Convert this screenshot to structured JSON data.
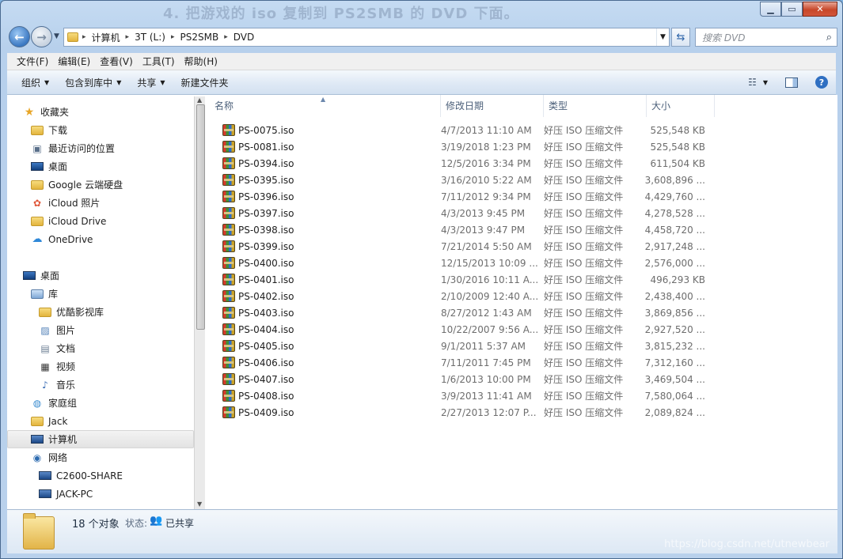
{
  "window": {
    "ghost_title": "4.   把游戏的 iso 复制到 PS2SMB 的 DVD 下面。",
    "min_icon": "minimize-icon",
    "max_icon": "maximize-icon",
    "close_label": "✕"
  },
  "address_bar": {
    "segments": [
      "计算机",
      "3T (L:)",
      "PS2SMB",
      "DVD"
    ],
    "separator": "▸"
  },
  "search": {
    "placeholder": "搜索 DVD"
  },
  "menu": {
    "items": [
      "文件(F)",
      "编辑(E)",
      "查看(V)",
      "工具(T)",
      "帮助(H)"
    ]
  },
  "toolbar": {
    "organize": "组织",
    "include_in_library": "包含到库中",
    "share": "共享",
    "new_folder": "新建文件夹"
  },
  "nav": {
    "favorites": [
      "收藏夹",
      "下载",
      "最近访问的位置",
      "桌面",
      "Google 云端硬盘",
      "iCloud 照片",
      "iCloud Drive",
      "OneDrive"
    ],
    "desktop": "桌面",
    "library": "库",
    "library_items": [
      "优酷影视库",
      "图片",
      "文档",
      "视频",
      "音乐"
    ],
    "homegroup": "家庭组",
    "user": "Jack",
    "computer": "计算机",
    "network": "网络",
    "network_items": [
      "C2600-SHARE",
      "JACK-PC"
    ]
  },
  "columns": {
    "name": "名称",
    "date": "修改日期",
    "type": "类型",
    "size": "大小"
  },
  "files": [
    {
      "name": "PS-0075.iso",
      "date": "4/7/2013 11:10 AM",
      "type": "好压 ISO 压缩文件",
      "size": "525,548 KB"
    },
    {
      "name": "PS-0081.iso",
      "date": "3/19/2018 1:23 PM",
      "type": "好压 ISO 压缩文件",
      "size": "525,548 KB"
    },
    {
      "name": "PS-0394.iso",
      "date": "12/5/2016 3:34 PM",
      "type": "好压 ISO 压缩文件",
      "size": "611,504 KB"
    },
    {
      "name": "PS-0395.iso",
      "date": "3/16/2010 5:22 AM",
      "type": "好压 ISO 压缩文件",
      "size": "3,608,896 ..."
    },
    {
      "name": "PS-0396.iso",
      "date": "7/11/2012 9:34 PM",
      "type": "好压 ISO 压缩文件",
      "size": "4,429,760 ..."
    },
    {
      "name": "PS-0397.iso",
      "date": "4/3/2013 9:45 PM",
      "type": "好压 ISO 压缩文件",
      "size": "4,278,528 ..."
    },
    {
      "name": "PS-0398.iso",
      "date": "4/3/2013 9:47 PM",
      "type": "好压 ISO 压缩文件",
      "size": "4,458,720 ..."
    },
    {
      "name": "PS-0399.iso",
      "date": "7/21/2014 5:50 AM",
      "type": "好压 ISO 压缩文件",
      "size": "2,917,248 ..."
    },
    {
      "name": "PS-0400.iso",
      "date": "12/15/2013 10:09 ...",
      "type": "好压 ISO 压缩文件",
      "size": "2,576,000 ..."
    },
    {
      "name": "PS-0401.iso",
      "date": "1/30/2016 10:11 A...",
      "type": "好压 ISO 压缩文件",
      "size": "496,293 KB"
    },
    {
      "name": "PS-0402.iso",
      "date": "2/10/2009 12:40 A...",
      "type": "好压 ISO 压缩文件",
      "size": "2,438,400 ..."
    },
    {
      "name": "PS-0403.iso",
      "date": "8/27/2012 1:43 AM",
      "type": "好压 ISO 压缩文件",
      "size": "3,869,856 ..."
    },
    {
      "name": "PS-0404.iso",
      "date": "10/22/2007 9:56 A...",
      "type": "好压 ISO 压缩文件",
      "size": "2,927,520 ..."
    },
    {
      "name": "PS-0405.iso",
      "date": "9/1/2011 5:37 AM",
      "type": "好压 ISO 压缩文件",
      "size": "3,815,232 ..."
    },
    {
      "name": "PS-0406.iso",
      "date": "7/11/2011 7:45 PM",
      "type": "好压 ISO 压缩文件",
      "size": "7,312,160 ..."
    },
    {
      "name": "PS-0407.iso",
      "date": "1/6/2013 10:00 PM",
      "type": "好压 ISO 压缩文件",
      "size": "3,469,504 ..."
    },
    {
      "name": "PS-0408.iso",
      "date": "3/9/2013 11:41 AM",
      "type": "好压 ISO 压缩文件",
      "size": "7,580,064 ..."
    },
    {
      "name": "PS-0409.iso",
      "date": "2/27/2013 12:07 P...",
      "type": "好压 ISO 压缩文件",
      "size": "2,089,824 ..."
    }
  ],
  "status": {
    "count": "18 个对象",
    "state_label": "状态:",
    "state_value": "已共享"
  },
  "watermark": "https://blog.csdn.net/utnewbear"
}
